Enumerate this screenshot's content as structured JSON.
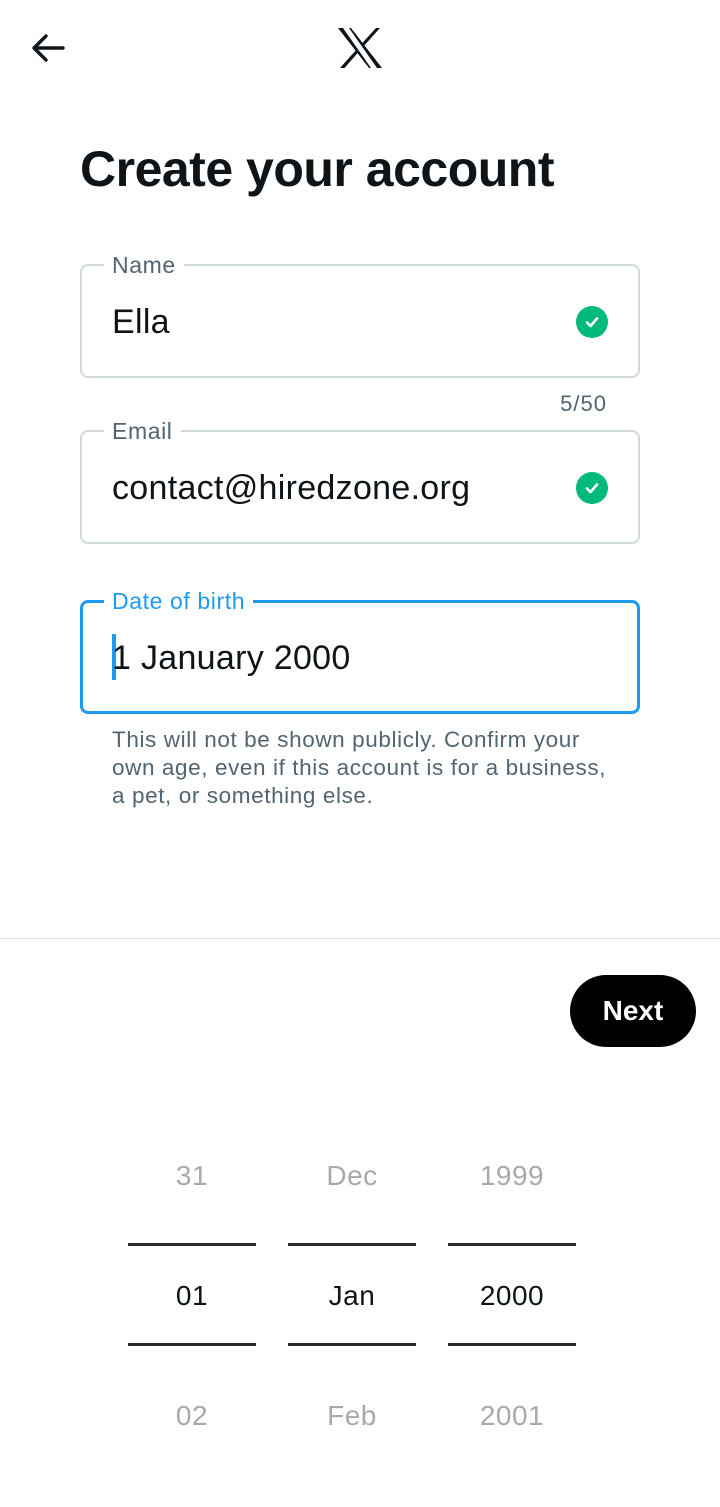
{
  "header": {
    "back_icon": "arrow-left-icon",
    "logo_icon": "x-logo-icon"
  },
  "title": "Create your account",
  "fields": {
    "name": {
      "label": "Name",
      "value": "Ella",
      "counter": "5/50",
      "valid": true
    },
    "email": {
      "label": "Email",
      "value": "contact@hiredzone.org",
      "valid": true
    },
    "dob": {
      "label": "Date of birth",
      "value": "1 January 2000"
    }
  },
  "helper_text": "This will not be shown publicly. Confirm your own age, even if this account is for a business, a pet, or something else.",
  "next_label": "Next",
  "picker": {
    "day": {
      "prev": "31",
      "selected": "01",
      "next": "02"
    },
    "month": {
      "prev": "Dec",
      "selected": "Jan",
      "next": "Feb"
    },
    "year": {
      "prev": "1999",
      "selected": "2000",
      "next": "2001"
    }
  },
  "colors": {
    "accent": "#1d9bf0",
    "success": "#00ba7c",
    "button_bg": "#000000",
    "border": "#cfd9de",
    "muted": "#536471"
  }
}
